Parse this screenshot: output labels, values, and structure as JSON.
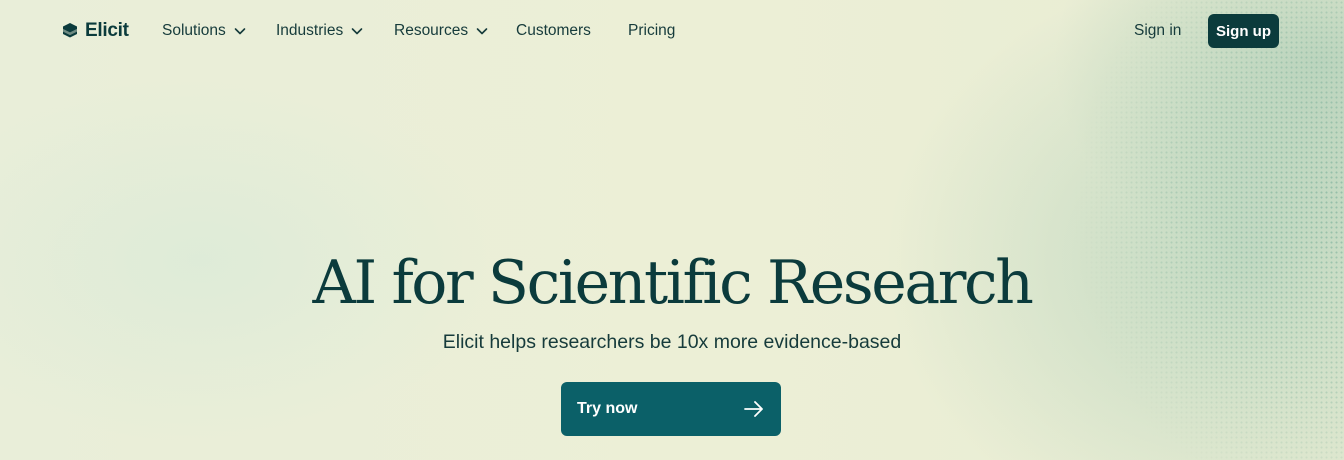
{
  "brand": {
    "name": "Elicit",
    "logo_icon": "elicit-logo-icon"
  },
  "nav": {
    "items": [
      {
        "label": "Solutions",
        "dropdown": true
      },
      {
        "label": "Industries",
        "dropdown": true
      },
      {
        "label": "Resources",
        "dropdown": true
      },
      {
        "label": "Customers",
        "dropdown": false
      },
      {
        "label": "Pricing",
        "dropdown": false
      }
    ],
    "sign_in": "Sign in",
    "sign_up": "Sign up"
  },
  "hero": {
    "title": "AI for Scientific Research",
    "subtitle": "Elicit helps researchers be 10x more evidence-based",
    "cta_label": "Try now",
    "cta_icon": "arrow-right-icon"
  },
  "colors": {
    "primary": "#0b3b3c",
    "cta": "#0b6068",
    "background": "#ecefd8"
  }
}
